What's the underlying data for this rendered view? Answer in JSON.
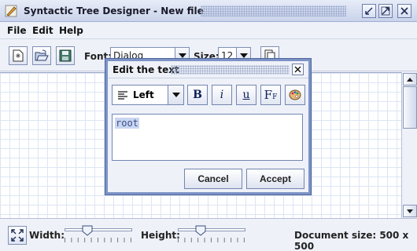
{
  "window": {
    "title": "Syntactic Tree Designer - New file",
    "controls": [
      "minimize-icon",
      "maximize-icon",
      "close-icon"
    ]
  },
  "menu": {
    "file": "File",
    "edit": "Edit",
    "help": "Help"
  },
  "toolbar": {
    "new_icon": "new-document-icon",
    "open_icon": "open-folder-icon",
    "save_icon": "save-disk-icon",
    "font_label": "Font:",
    "font_value": "Dialog",
    "size_label": "Size:",
    "size_value": "12",
    "copy_icon": "copy-icon"
  },
  "status": {
    "fit_icon": "fit-to-window-icon",
    "width_label": "Width:",
    "width_level": 0.3,
    "height_label": "Height:",
    "height_level": 0.3,
    "document_size": "Document size: 500 x 500"
  },
  "dialog": {
    "title": "Edit the text",
    "align_value": "Left",
    "bold_label": "B",
    "italic_label": "i",
    "underline_label": "u",
    "font_icon_label": "F",
    "palette_icon": "color-palette-icon",
    "text_value": "root",
    "cancel_label": "Cancel",
    "accept_label": "Accept"
  },
  "colors": {
    "accent": "#7d93c6",
    "grid": "#dde5f3",
    "selection": "#c9d6f1"
  }
}
